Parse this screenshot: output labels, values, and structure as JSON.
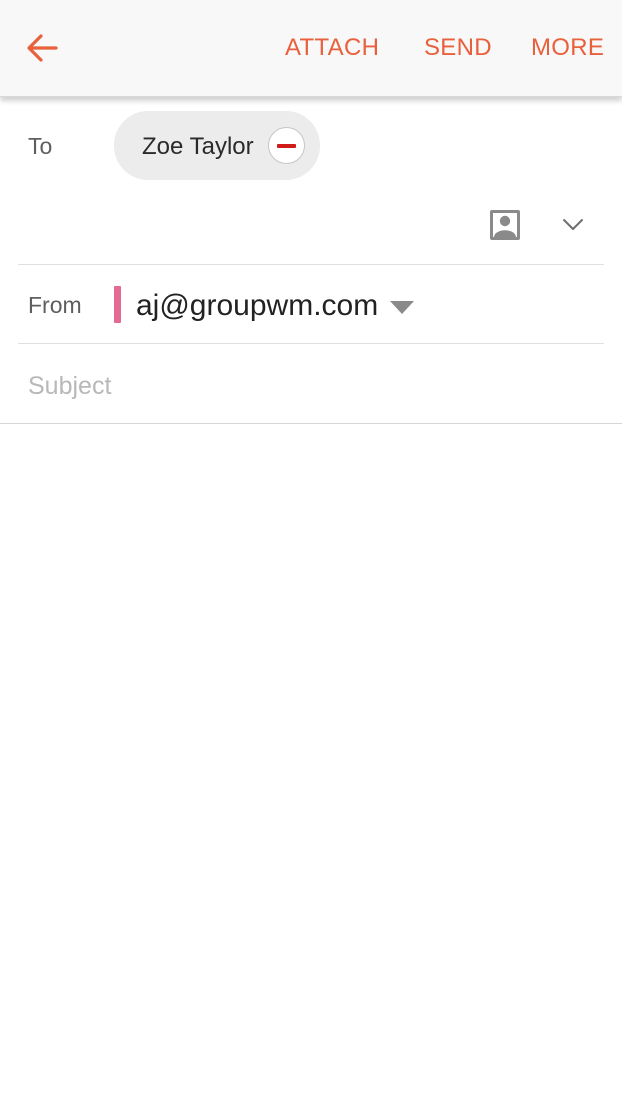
{
  "toolbar": {
    "back_icon": "arrow-left-icon",
    "attach_label": "ATTACH",
    "send_label": "SEND",
    "more_label": "MORE",
    "accent_color": "#e8603c"
  },
  "recipients": {
    "to_label": "To",
    "chips": [
      {
        "name": "Zoe Taylor",
        "remove_icon": "minus-circle-icon"
      }
    ],
    "contact_picker_icon": "contact-book-icon",
    "expand_icon": "chevron-down-icon"
  },
  "sender": {
    "from_label": "From",
    "account": "aj@groupwm.com",
    "account_color": "#e56a93",
    "dropdown_icon": "caret-down-icon"
  },
  "subject": {
    "placeholder": "Subject",
    "value": ""
  }
}
